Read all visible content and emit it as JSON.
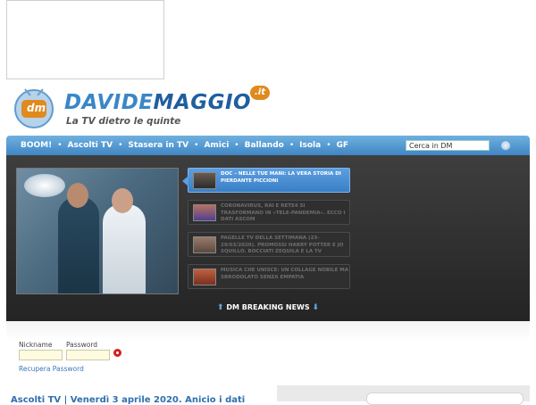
{
  "logo": {
    "name_part1": "DAVIDE",
    "name_part2": "MAGGIO",
    "tld": ".it",
    "tagline": "La TV dietro le quinte",
    "badge_letters": "dm"
  },
  "nav": {
    "items": [
      "BOOM!",
      "Ascolti TV",
      "Stasera in TV",
      "Amici",
      "Ballando",
      "Isola",
      "GF"
    ],
    "search_value": "Cerca in DM"
  },
  "featured": {
    "news": [
      {
        "text": "DOC – NELLE TUE MANI: LA VERA STORIA DI PIERDANTE PICCIONI",
        "active": true
      },
      {
        "text": "CORONAVIRUS, RAI E RETE4 SI TRASFORMANO IN «TELE-PANDEMIA». ECCO I DATI ASCOM",
        "active": false
      },
      {
        "text": "PAGELLE TV DELLA SETTIMANA (23-29/03/2020). PROMOSSI HARRY POTTER E JO SQUILLO. BOCCIATI ZEQUILA E LA TV",
        "active": false
      },
      {
        "text": "MUSICA CHE UNISCE: UN COLLAGE NOBILE MA SBRODOLATO SENZA EMPATIA",
        "active": false
      }
    ],
    "breaking_label": "DM BREAKING NEWS"
  },
  "login": {
    "nickname_label": "Nickname",
    "password_label": "Password",
    "recover_label": "Recupera Password"
  },
  "bottom": {
    "headline": "Ascolti TV | Venerdì 3 aprile 2020. Anicio i dati"
  },
  "colors": {
    "brand_blue": "#3a86c8",
    "nav_blue": "#4f96d0",
    "accent_orange": "#e08a1e",
    "login_red": "#d32020"
  }
}
